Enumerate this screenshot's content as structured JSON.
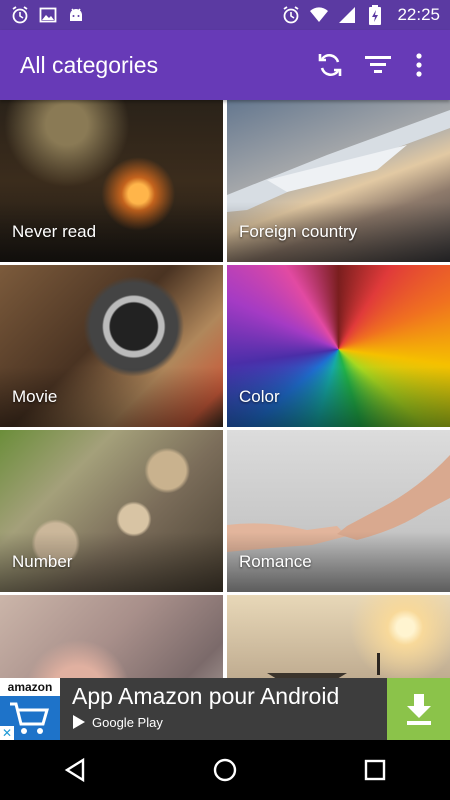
{
  "status_bar": {
    "time": "22:25",
    "left_icons": [
      "alarm-icon",
      "image-icon",
      "android-icon"
    ],
    "right_icons": [
      "alarm-icon",
      "wifi-icon",
      "signal-icon",
      "battery-icon"
    ]
  },
  "app_bar": {
    "title": "All categories",
    "actions": [
      "refresh-icon",
      "filter-icon",
      "more-vert-icon"
    ],
    "color": "#673ab7"
  },
  "categories": [
    {
      "label": "Never read"
    },
    {
      "label": "Foreign country"
    },
    {
      "label": "Movie"
    },
    {
      "label": "Color"
    },
    {
      "label": "Number"
    },
    {
      "label": "Romance"
    },
    {
      "label": ""
    },
    {
      "label": ""
    }
  ],
  "ad": {
    "logo_text": "amazon",
    "title": "App Amazon pour Android",
    "store_label": "Google Play",
    "button_icon": "download-icon",
    "close_icon": "close-icon"
  },
  "nav_bar": {
    "buttons": [
      "back-icon",
      "home-icon",
      "recents-icon"
    ]
  }
}
